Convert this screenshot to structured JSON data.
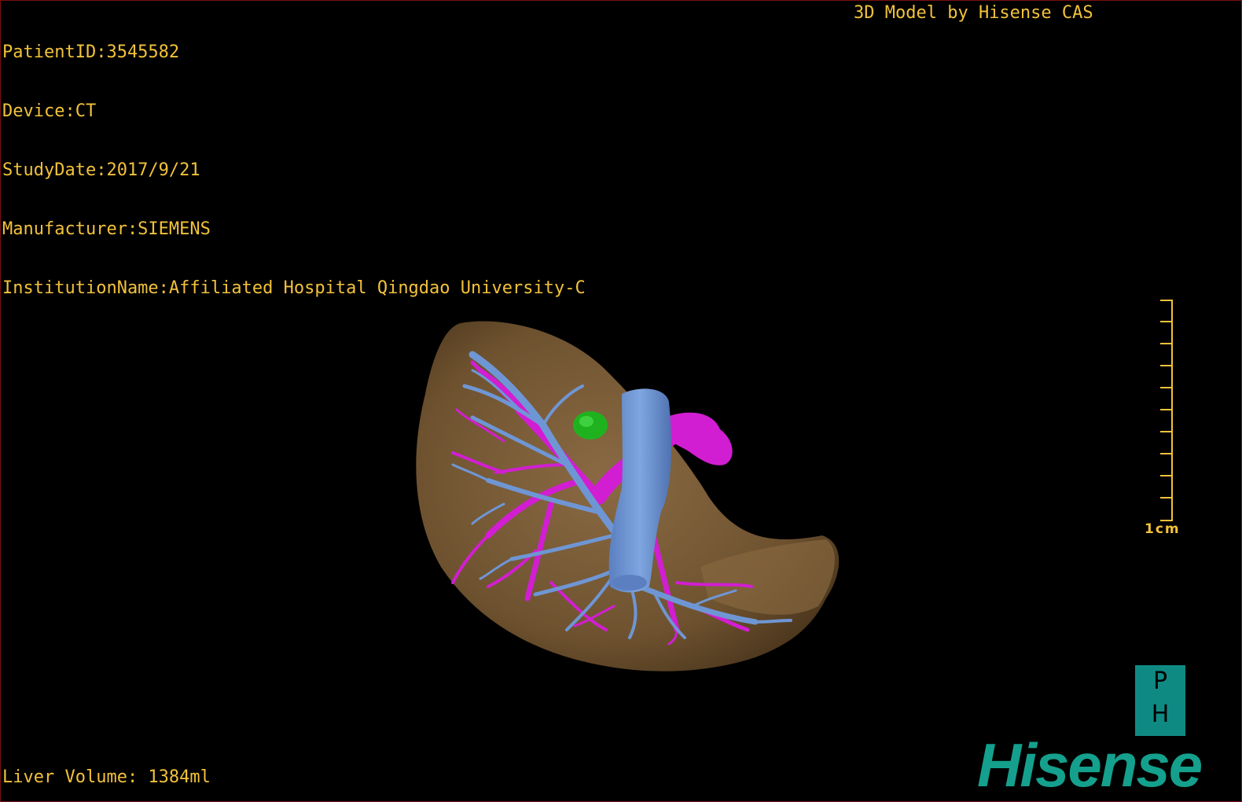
{
  "overlay": {
    "patient_id": "PatientID:3545582",
    "device": "Device:CT",
    "study_date": "StudyDate:2017/9/21",
    "manufacturer": "Manufacturer:SIEMENS",
    "institution": "InstitutionName:Affiliated Hospital Qingdao University-C",
    "credit": "3D Model by Hisense CAS",
    "liver_volume": "Liver Volume: 1384ml"
  },
  "scale_bar": {
    "label": "1cm"
  },
  "branding": {
    "badge_top": "P",
    "badge_bottom": "H",
    "logo": "Hisense"
  },
  "colors": {
    "overlay_text": "#f2c23a",
    "liver": "#7a5a36",
    "hepatic_vein": "#6f96d4",
    "portal_vein": "#d21ed2",
    "lesion": "#1fb21f",
    "brand": "#14a08d",
    "frame": "#7a1010"
  },
  "model": {
    "structures": [
      "liver-surface",
      "hepatic-vein-tree",
      "portal-vein-tree",
      "inferior-vena-cava",
      "lesion"
    ]
  }
}
